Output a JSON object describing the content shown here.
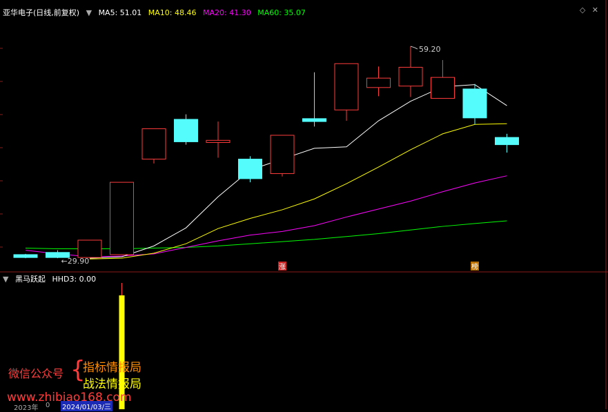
{
  "header": {
    "title": "亚华电子(日线,前复权)",
    "ma": [
      {
        "label": "MA5: 51.01",
        "color": "#ffffff"
      },
      {
        "label": "MA10: 48.46",
        "color": "#ffff00"
      },
      {
        "label": "MA20: 41.30",
        "color": "#ff00ff"
      },
      {
        "label": "MA60: 35.07",
        "color": "#00ff00"
      }
    ]
  },
  "indicator": {
    "name": "黑马跃起",
    "value_label": "HHD3: 0.00"
  },
  "footer": {
    "year_label": "2023年",
    "zero_label": "0",
    "date_label": "2024/01/03/三"
  },
  "watermark": {
    "left": "微信公众号",
    "brace": "{",
    "line1": "指标情报局",
    "line2": "战法情报局",
    "url": "www.zhibiao168.com"
  },
  "colors": {
    "up": "#ff3c3c",
    "down": "#54fcfc",
    "ma5": "#ffffff",
    "ma10": "#ffff00",
    "ma20": "#ff00ff",
    "ma60": "#00ff00",
    "indicator_bar": "#ffff00"
  },
  "chart_data": {
    "type": "candlestick",
    "annotations": {
      "high": "59.20",
      "low": "29.90",
      "badges": [
        "涨",
        "榜"
      ]
    },
    "candles": [
      {
        "o": 30.4,
        "c": 30.0,
        "h": 30.5,
        "l": 29.9
      },
      {
        "o": 30.7,
        "c": 30.0,
        "h": 31.0,
        "l": 29.9
      },
      {
        "o": 30.0,
        "c": 32.4,
        "h": 32.4,
        "l": 29.9
      },
      {
        "o": 30.4,
        "c": 40.4,
        "h": 40.4,
        "l": 30.4
      },
      {
        "o": 43.6,
        "c": 47.8,
        "h": 47.8,
        "l": 43.0
      },
      {
        "o": 49.1,
        "c": 46.0,
        "h": 49.8,
        "l": 45.6
      },
      {
        "o": 45.9,
        "c": 46.2,
        "h": 48.8,
        "l": 43.8
      },
      {
        "o": 43.6,
        "c": 40.9,
        "h": 44.0,
        "l": 40.4
      },
      {
        "o": 41.6,
        "c": 46.9,
        "h": 46.9,
        "l": 41.2
      },
      {
        "o": 49.2,
        "c": 48.8,
        "h": 55.6,
        "l": 48.1
      },
      {
        "o": 50.4,
        "c": 56.8,
        "h": 56.8,
        "l": 48.9
      },
      {
        "o": 53.5,
        "c": 54.8,
        "h": 56.4,
        "l": 52.3
      },
      {
        "o": 53.7,
        "c": 56.3,
        "h": 59.2,
        "l": 52.2
      },
      {
        "o": 52.0,
        "c": 54.9,
        "h": 57.3,
        "l": 52.0
      },
      {
        "o": 53.3,
        "c": 49.3,
        "h": 54.0,
        "l": 48.4
      },
      {
        "o": 46.6,
        "c": 45.6,
        "h": 47.1,
        "l": 44.5
      }
    ],
    "ma5": [
      null,
      null,
      29.9,
      30.1,
      31.6,
      34.1,
      38.4,
      42.1,
      43.6,
      45.1,
      45.3,
      48.9,
      51.6,
      53.6,
      53.9,
      51.0
    ],
    "ma10": [
      null,
      null,
      29.8,
      29.9,
      30.6,
      31.9,
      34.0,
      35.4,
      36.6,
      38.1,
      40.2,
      42.5,
      44.9,
      47.1,
      48.4,
      48.5
    ],
    "ma20": [
      31.0,
      30.5,
      30.1,
      30.2,
      30.5,
      31.4,
      32.3,
      33.1,
      33.6,
      34.4,
      35.6,
      36.7,
      37.8,
      39.1,
      40.3,
      41.3
    ],
    "ma60": [
      31.3,
      31.2,
      31.2,
      31.2,
      31.3,
      31.4,
      31.6,
      31.9,
      32.2,
      32.5,
      32.9,
      33.3,
      33.8,
      34.3,
      34.7,
      35.07
    ],
    "indicator_values": [
      0,
      0,
      0,
      0,
      0,
      0,
      0,
      0,
      0,
      0,
      0,
      0,
      0,
      0,
      0,
      0
    ],
    "indicator_signal_index": 3
  }
}
